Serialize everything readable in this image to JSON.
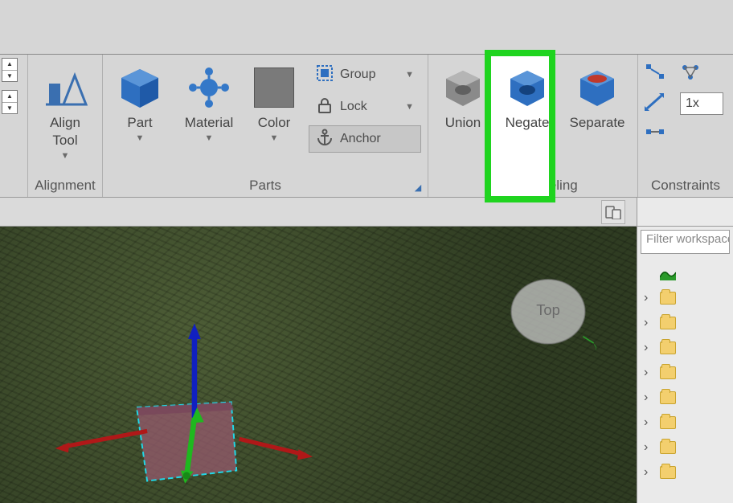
{
  "ribbon": {
    "spinners": [
      "",
      ""
    ],
    "alignment": {
      "align_tool": "Align\nTool",
      "group_label": "Alignment"
    },
    "parts": {
      "part": "Part",
      "material": "Material",
      "color": "Color",
      "group": "Group",
      "lock": "Lock",
      "anchor": "Anchor",
      "group_label": "Parts"
    },
    "solid": {
      "union": "Union",
      "negate": "Negate",
      "separate": "Separate",
      "group_label": "Solid Modeling"
    },
    "constraints": {
      "scale_value": "1x",
      "group_label": "Constraints"
    }
  },
  "side": {
    "filter_placeholder": "Filter workspace",
    "rows": [
      "",
      "",
      "",
      "",
      "",
      "",
      "",
      ""
    ]
  },
  "viewport": {
    "camera_label": "Top"
  }
}
